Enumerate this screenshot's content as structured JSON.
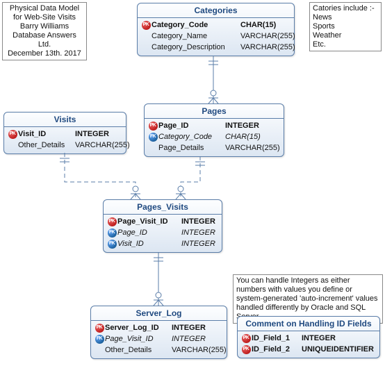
{
  "meta_note": {
    "l1": "Physical Data Model",
    "l2": "for Web-Site Visits",
    "l3": "Barry Williams",
    "l4": "Database Answers Ltd.",
    "l5": "December 13th. 2017"
  },
  "cat_note": {
    "l1": "Catories include :-",
    "l2": "News",
    "l3": "Sports",
    "l4": "Weather",
    "l5": "Etc."
  },
  "int_note": {
    "text": "You can handle Integers as either numbers with values you define or system-generated 'auto-increment' values handled differently by Oracle and SQL Server."
  },
  "entities": {
    "categories": {
      "title": "Categories",
      "rows": [
        {
          "k": "pk",
          "name": "Category_Code",
          "type": "CHAR(15)",
          "bold": true
        },
        {
          "k": "",
          "name": "Category_Name",
          "type": "VARCHAR(255)"
        },
        {
          "k": "",
          "name": "Category_Description",
          "type": "VARCHAR(255)"
        }
      ]
    },
    "pages": {
      "title": "Pages",
      "rows": [
        {
          "k": "pk",
          "name": "Page_ID",
          "type": "INTEGER",
          "bold": true
        },
        {
          "k": "fk",
          "name": "Category_Code",
          "type": "CHAR(15)",
          "italic": true
        },
        {
          "k": "",
          "name": "Page_Details",
          "type": "VARCHAR(255)"
        }
      ]
    },
    "visits": {
      "title": "Visits",
      "rows": [
        {
          "k": "pk",
          "name": "Visit_ID",
          "type": "INTEGER",
          "bold": true
        },
        {
          "k": "",
          "name": "Other_Details",
          "type": "VARCHAR(255)"
        }
      ]
    },
    "pages_visits": {
      "title": "Pages_Visits",
      "rows": [
        {
          "k": "pk",
          "name": "Page_Visit_ID",
          "type": "INTEGER",
          "bold": true
        },
        {
          "k": "fk",
          "name": "Page_ID",
          "type": "INTEGER",
          "italic": true
        },
        {
          "k": "fk",
          "name": "Visit_ID",
          "type": "INTEGER",
          "italic": true
        }
      ]
    },
    "server_log": {
      "title": "Server_Log",
      "rows": [
        {
          "k": "pk",
          "name": "Server_Log_ID",
          "type": "INTEGER",
          "bold": true
        },
        {
          "k": "fk",
          "name": "Page_Visit_ID",
          "type": "INTEGER",
          "italic": true
        },
        {
          "k": "",
          "name": "Other_Details",
          "type": "VARCHAR(255)"
        }
      ]
    },
    "comment": {
      "title": "Comment on Handling ID Fields",
      "rows": [
        {
          "k": "pk",
          "name": "ID_Field_1",
          "type": "INTEGER",
          "bold": true
        },
        {
          "k": "pk",
          "name": "ID_Field_2",
          "type": "UNIQUEIDENTIFIER",
          "bold": true
        }
      ]
    }
  }
}
